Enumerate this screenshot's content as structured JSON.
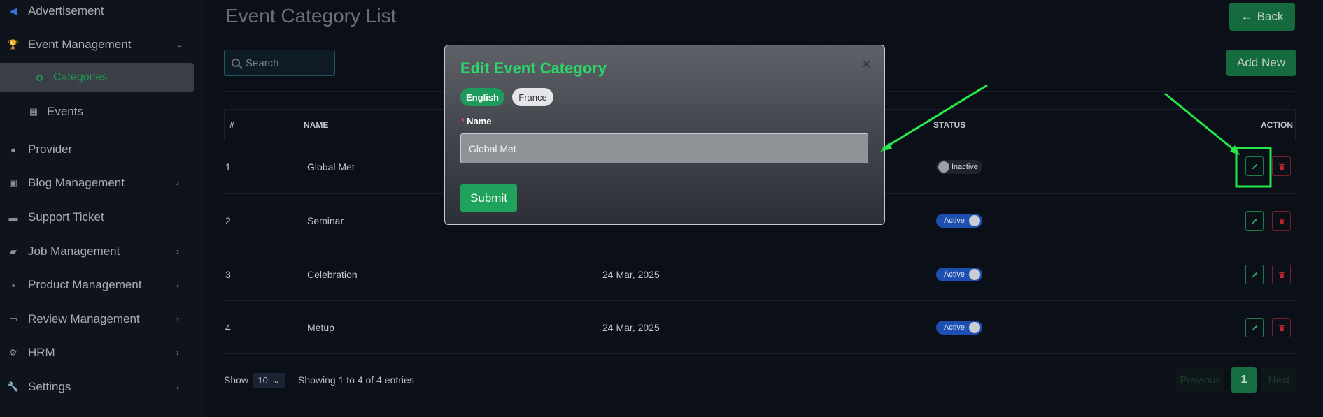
{
  "sidebar": {
    "items": [
      {
        "label": "Advertisement",
        "icon": "megaphone-icon"
      },
      {
        "label": "Event Management",
        "icon": "trophy-icon",
        "expanded": true
      },
      {
        "label": "Categories",
        "icon": "circle-icon",
        "active": true
      },
      {
        "label": "Events",
        "icon": "calendar-icon"
      },
      {
        "label": "Provider",
        "icon": "user-icon"
      },
      {
        "label": "Blog Management",
        "icon": "blog-icon"
      },
      {
        "label": "Support Ticket",
        "icon": "ticket-icon"
      },
      {
        "label": "Job Management",
        "icon": "briefcase-icon"
      },
      {
        "label": "Product Management",
        "icon": "grid-icon"
      },
      {
        "label": "Review Management",
        "icon": "review-icon"
      },
      {
        "label": "HRM",
        "icon": "people-icon"
      },
      {
        "label": "Settings",
        "icon": "wrench-icon"
      }
    ]
  },
  "header": {
    "title": "Event Category List",
    "back_label": "Back",
    "add_label": "Add New"
  },
  "search": {
    "placeholder": "Search"
  },
  "table": {
    "columns": [
      "#",
      "NAME",
      "STATUS",
      "ACTION"
    ],
    "rows": [
      {
        "num": "1",
        "name": "Global Met",
        "date": "",
        "status": "Inactive"
      },
      {
        "num": "2",
        "name": "Seminar",
        "date": "",
        "status": "Active"
      },
      {
        "num": "3",
        "name": "Celebration",
        "date": "24 Mar, 2025",
        "status": "Active"
      },
      {
        "num": "4",
        "name": "Metup",
        "date": "24 Mar, 2025",
        "status": "Active"
      }
    ]
  },
  "footer": {
    "show_label": "Show",
    "page_size": "10",
    "entries_text": "Showing 1 to 4 of 4 entries",
    "prev_label": "Previous",
    "current_page": "1",
    "next_label": "Next"
  },
  "modal": {
    "title": "Edit Event Category",
    "languages": [
      "English",
      "France"
    ],
    "selected_language": "English",
    "field_label": "Name",
    "required_mark": "*",
    "name_value": "Global Met",
    "submit_label": "Submit",
    "close_symbol": "×"
  },
  "colors": {
    "accent_green": "#1fa35c",
    "title_green": "#2bd86a",
    "danger_red": "#7a1f25",
    "annotation_green": "#27e84a"
  }
}
